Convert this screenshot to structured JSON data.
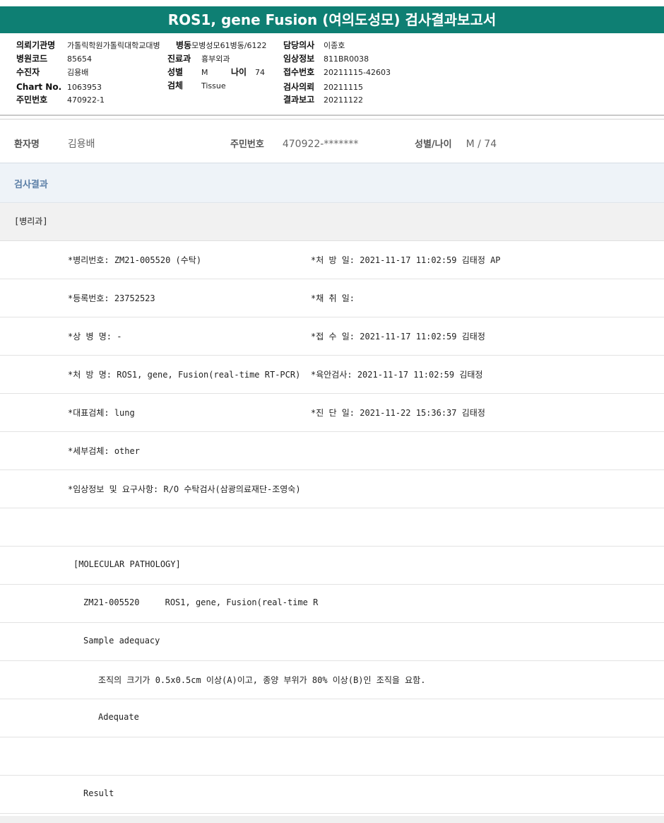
{
  "title": "ROS1, gene Fusion (여의도성모) 검사결과보고서",
  "info": {
    "col1": [
      {
        "label": "의뢰기관명",
        "value": "가톨릭학원가톨릭대학교대병"
      },
      {
        "label": "병원코드",
        "value": "85654"
      },
      {
        "label": "수진자",
        "value": "김용배"
      },
      {
        "label": "Chart No.",
        "value": "1063953"
      },
      {
        "label": "주민번호",
        "value": "470922-1"
      }
    ],
    "col2": [
      {
        "label": "병동",
        "value": "모병성모61병동/6122"
      },
      {
        "label": "진료과",
        "value": "흉부외과"
      },
      {
        "label": "성별",
        "value": "M"
      },
      {
        "label": "검체",
        "value": "Tissue"
      }
    ],
    "age": {
      "label": "나이",
      "value": "74"
    },
    "col3": [
      {
        "label": "담당의사",
        "value": "이종호"
      },
      {
        "label": "임상정보",
        "value": "811BR0038"
      },
      {
        "label": "접수번호",
        "value": "20211115-42603"
      },
      {
        "label": "검사의뢰",
        "value": "20211115"
      },
      {
        "label": "결과보고",
        "value": "20211122"
      }
    ]
  },
  "patient": {
    "name_label": "환자명",
    "name": "김용배",
    "id_label": "주민번호",
    "id": "470922-*******",
    "sexage_label": "성별/나이",
    "sexage": "M / 74"
  },
  "section_title": "검사결과",
  "department": "[병리과]",
  "rows": [
    {
      "a": "*병리번호: ZM21-005520 (수탁)",
      "b": "*처 방 일: 2021-11-17 11:02:59  김태정 AP"
    },
    {
      "a": "*등록번호: 23752523",
      "b": "*채 취 일:"
    },
    {
      "a": "*상 병 명: -",
      "b": "*접 수 일: 2021-11-17 11:02:59  김태정"
    },
    {
      "a": "*처 방 명: ROS1, gene, Fusion(real-time RT-PCR)",
      "b": "*육안검사: 2021-11-17 11:02:59  김태정"
    },
    {
      "a": "*대표검체: lung",
      "b": "*진 단 일: 2021-11-22 15:36:37  김태정"
    },
    {
      "a": "*세부검체: other",
      "b": ""
    },
    {
      "a": "*임상정보 및 요구사항: R/O 수탁검사(삼광의료재단-조영숙)",
      "b": ""
    },
    {
      "a": "",
      "b": ""
    },
    {
      "a": "[MOLECULAR PATHOLOGY]",
      "b": ""
    },
    {
      "a": "ZM21-005520     ROS1, gene, Fusion(real-time R",
      "b": ""
    },
    {
      "a": "Sample adequacy",
      "b": ""
    },
    {
      "a": "조직의 크기가 0.5x0.5cm 이상(A)이고, 종양 부위가 80% 이상(B)인 조직을 요함.",
      "b": ""
    },
    {
      "a": "Adequate",
      "b": ""
    },
    {
      "a": "",
      "b": ""
    },
    {
      "a": "Result",
      "b": ""
    }
  ]
}
